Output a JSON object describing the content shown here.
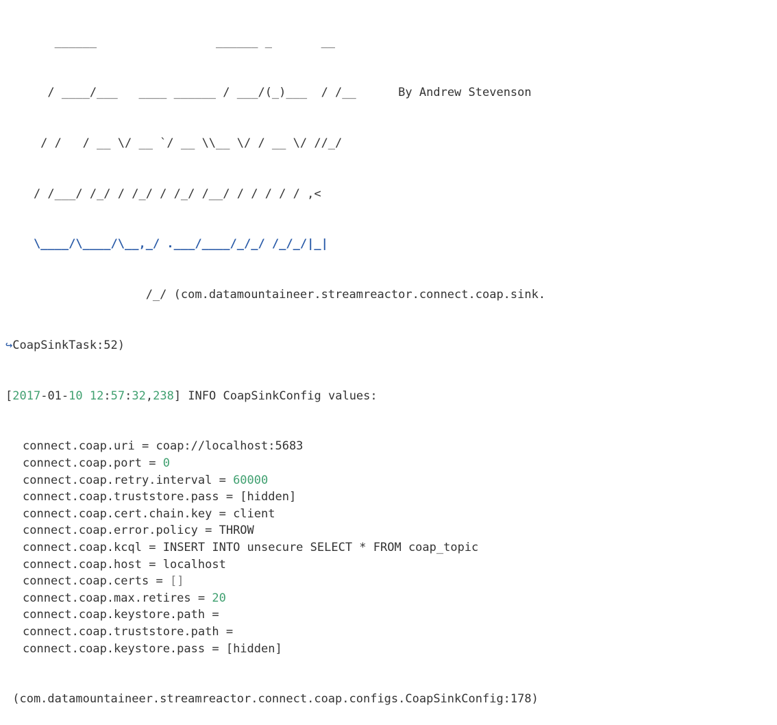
{
  "ascii_banner": {
    "row1": "       ______                 ______ _       __",
    "row2a": "      / ____/___   ____ ______ / ___/(_)___  / /__",
    "byline": "By Andrew Stevenson",
    "row3": "     / /   / __ \\/ __ `/ __ \\\\__ \\/ / __ \\/ //_/",
    "row4": "    / /___/ /_/ / /_/ / /_/ /__/ / / / / / ,<",
    "row5": "    \\____/\\____/\\__,_/ .___/____/_/_/ /_/_/|_|",
    "row6_prefix": "                    /_/ ",
    "row6_text": "(com.datamountaineer.streamreactor.connect.coap.sink."
  },
  "wrap_continuation": {
    "icon": "↪",
    "text": "CoapSinkTask:52)"
  },
  "log_header": {
    "bracket_open": "[",
    "year": "2017",
    "date_rest": "-01-",
    "day": "10",
    "space": " ",
    "hour": "12",
    "time_rest": ":",
    "min": "57",
    "colon": ":",
    "sec": "32",
    "comma": ",",
    "ms": "238",
    "bracket_close": "]",
    "message": " INFO CoapSinkConfig values:"
  },
  "config_values": [
    {
      "key": "connect.coap.uri",
      "value": "coap://localhost:5683",
      "kind": "text"
    },
    {
      "key": "connect.coap.port",
      "value": "0",
      "kind": "num"
    },
    {
      "key": "connect.coap.retry.interval",
      "value": "60000",
      "kind": "num"
    },
    {
      "key": "connect.coap.truststore.pass",
      "value": "[hidden]",
      "kind": "text"
    },
    {
      "key": "connect.coap.cert.chain.key",
      "value": "client",
      "kind": "text"
    },
    {
      "key": "connect.coap.error.policy",
      "value": "THROW",
      "kind": "text"
    },
    {
      "key": "connect.coap.kcql",
      "value": "INSERT INTO unsecure SELECT * FROM coap_topic",
      "kind": "text"
    },
    {
      "key": "connect.coap.host",
      "value": "localhost",
      "kind": "text"
    },
    {
      "key": "connect.coap.certs",
      "value": "[]",
      "kind": "brk"
    },
    {
      "key": "connect.coap.max.retires",
      "value": "20",
      "kind": "num"
    },
    {
      "key": "connect.coap.keystore.path",
      "value": "",
      "kind": "text"
    },
    {
      "key": "connect.coap.truststore.path",
      "value": "",
      "kind": "text"
    },
    {
      "key": "connect.coap.keystore.pass",
      "value": "[hidden]",
      "kind": "text"
    }
  ],
  "footer_source": " (com.datamountaineer.streamreactor.connect.coap.configs.CoapSinkConfig:178)",
  "colors": {
    "text": "#333333",
    "number": "#40a070",
    "ascii_accent": "#2a5ba8"
  }
}
